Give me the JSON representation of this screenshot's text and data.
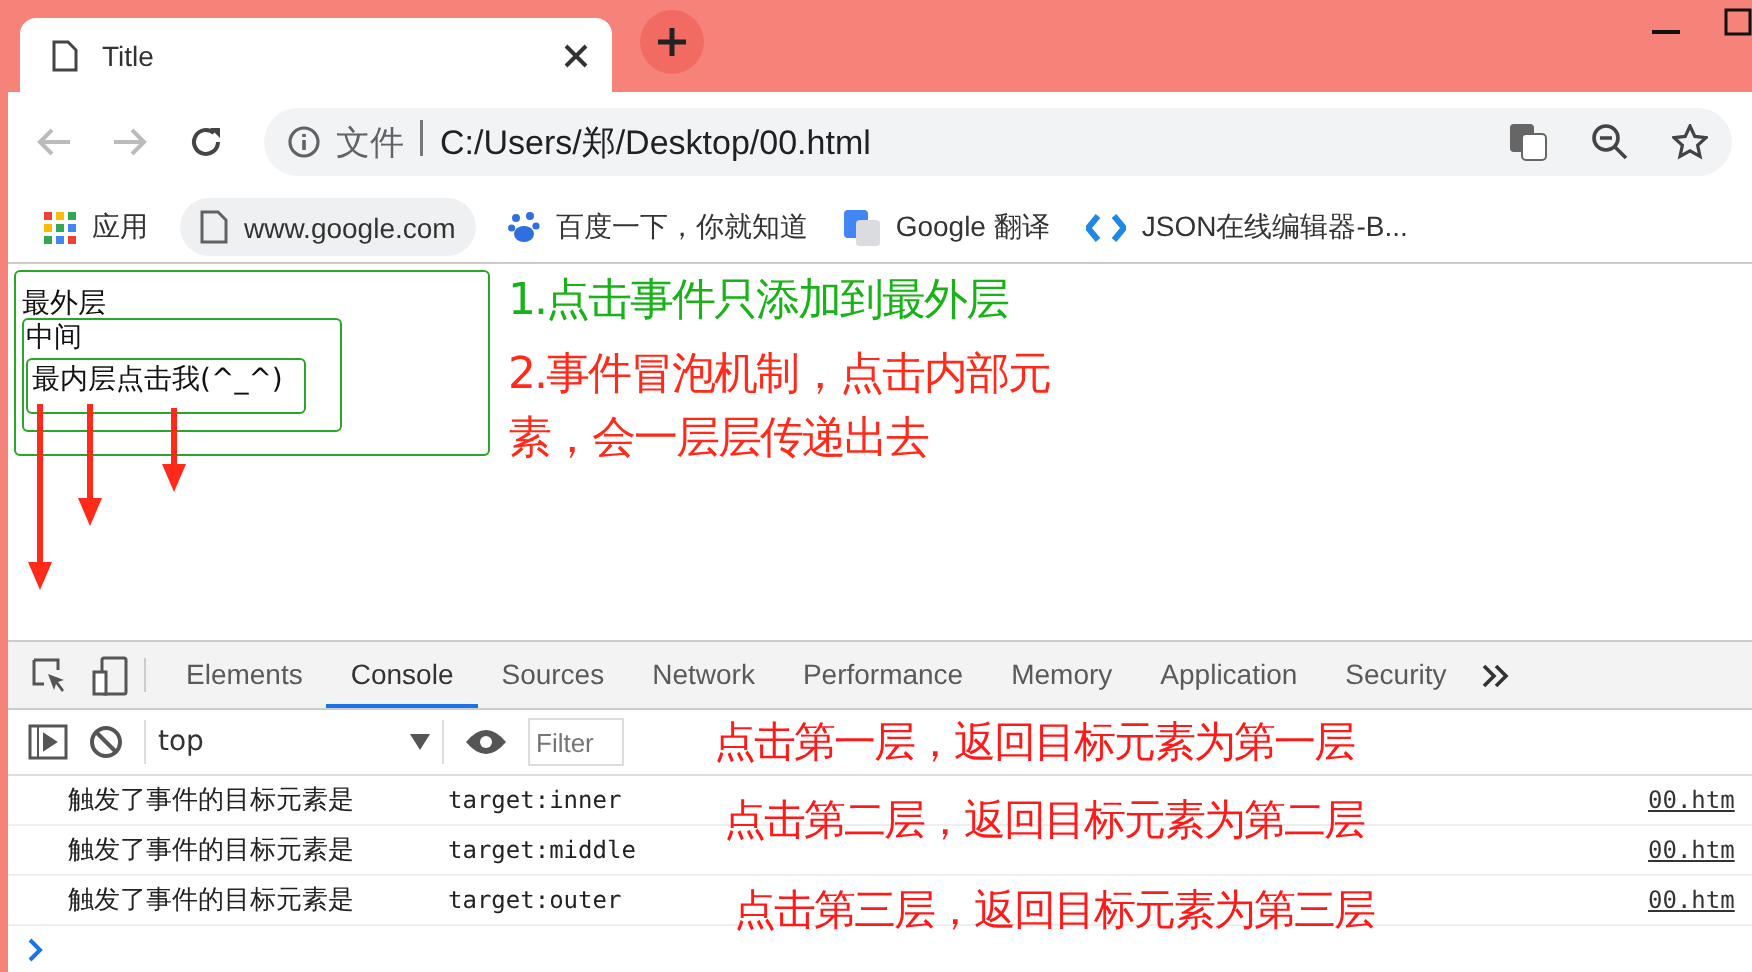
{
  "browser": {
    "tab": {
      "title": "Title"
    },
    "address": {
      "security_label": "文件",
      "url": "C:/Users/郑/Desktop/00.html"
    },
    "bookmarks": [
      {
        "label": "应用",
        "kind": "apps"
      },
      {
        "label": "www.google.com",
        "kind": "page"
      },
      {
        "label": "百度一下，你就知道",
        "kind": "paw"
      },
      {
        "label": "Google 翻译",
        "kind": "translate"
      },
      {
        "label": "JSON在线编辑器-B...",
        "kind": "code"
      }
    ]
  },
  "page": {
    "outer": "最外层",
    "middle": "中间",
    "inner": "最内层点击我(^_^)",
    "notes": [
      {
        "text": "1.点击事件只添加到最外层",
        "color": "#19b219"
      },
      {
        "text": "2.事件冒泡机制，点击内部元素，会一层层传递出去",
        "color": "#ff2a1a"
      }
    ]
  },
  "devtools": {
    "tabs": [
      {
        "label": "Elements",
        "selected": false
      },
      {
        "label": "Console",
        "selected": true
      },
      {
        "label": "Sources",
        "selected": false
      },
      {
        "label": "Network",
        "selected": false
      },
      {
        "label": "Performance",
        "selected": false
      },
      {
        "label": "Memory",
        "selected": false
      },
      {
        "label": "Application",
        "selected": false
      },
      {
        "label": "Security",
        "selected": false
      }
    ],
    "context": "top",
    "filter_placeholder": "Filter",
    "logs": [
      {
        "message": "触发了事件的目标元素是",
        "value": "target:inner",
        "source": "00.htm",
        "note": "点击第一层，返回目标元素为第一层"
      },
      {
        "message": "触发了事件的目标元素是",
        "value": "target:middle",
        "source": "00.htm",
        "note": "点击第二层，返回目标元素为第二层"
      },
      {
        "message": "触发了事件的目标元素是",
        "value": "target:outer",
        "source": "00.htm",
        "note": "点击第三层，返回目标元素为第三层"
      }
    ]
  }
}
